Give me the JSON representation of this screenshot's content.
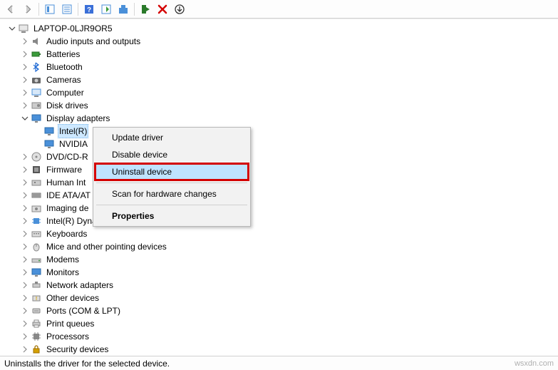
{
  "root": {
    "label": "LAPTOP-0LJR9OR5"
  },
  "categories": [
    {
      "label": "Audio inputs and outputs",
      "state": "closed"
    },
    {
      "label": "Batteries",
      "state": "closed"
    },
    {
      "label": "Bluetooth",
      "state": "closed"
    },
    {
      "label": "Cameras",
      "state": "closed"
    },
    {
      "label": "Computer",
      "state": "closed"
    },
    {
      "label": "Disk drives",
      "state": "closed"
    },
    {
      "label": "Display adapters",
      "state": "open",
      "children": [
        {
          "label": "Intel(R)",
          "selected": true
        },
        {
          "label": "NVIDIA"
        }
      ]
    },
    {
      "label": "DVD/CD-R",
      "state": "closed"
    },
    {
      "label": "Firmware",
      "state": "closed"
    },
    {
      "label": "Human Int",
      "state": "closed"
    },
    {
      "label": "IDE ATA/AT",
      "state": "closed"
    },
    {
      "label": "Imaging de",
      "state": "closed"
    },
    {
      "label": "Intel(R) Dynamic Platform and Thermal Framework",
      "state": "closed"
    },
    {
      "label": "Keyboards",
      "state": "closed"
    },
    {
      "label": "Mice and other pointing devices",
      "state": "closed"
    },
    {
      "label": "Modems",
      "state": "closed"
    },
    {
      "label": "Monitors",
      "state": "closed"
    },
    {
      "label": "Network adapters",
      "state": "closed"
    },
    {
      "label": "Other devices",
      "state": "closed"
    },
    {
      "label": "Ports (COM & LPT)",
      "state": "closed"
    },
    {
      "label": "Print queues",
      "state": "closed"
    },
    {
      "label": "Processors",
      "state": "closed"
    },
    {
      "label": "Security devices",
      "state": "closed"
    }
  ],
  "context_menu": {
    "items": [
      {
        "label": "Update driver"
      },
      {
        "label": "Disable device"
      },
      {
        "label": "Uninstall device",
        "highlighted": true
      },
      {
        "separator": true
      },
      {
        "label": "Scan for hardware changes"
      },
      {
        "separator": true
      },
      {
        "label": "Properties",
        "bold": true
      }
    ]
  },
  "status_text": "Uninstalls the driver for the selected device.",
  "watermark": "wsxdn.com",
  "icons": {
    "audio": "speaker-icon",
    "battery": "battery-icon",
    "bluetooth": "bluetooth-icon",
    "camera": "camera-icon",
    "computer": "computer-icon",
    "disk": "disk-icon",
    "display": "display-icon",
    "dvd": "dvd-icon",
    "firmware": "firmware-icon",
    "hid": "hid-icon",
    "ide": "ide-icon",
    "imaging": "imaging-icon",
    "platform": "platform-icon",
    "keyboard": "keyboard-icon",
    "mouse": "mouse-icon",
    "modem": "modem-icon",
    "monitor": "monitor-icon",
    "network": "network-icon",
    "other": "other-icon",
    "port": "port-icon",
    "printer": "printer-icon",
    "cpu": "cpu-icon",
    "security": "security-icon"
  }
}
